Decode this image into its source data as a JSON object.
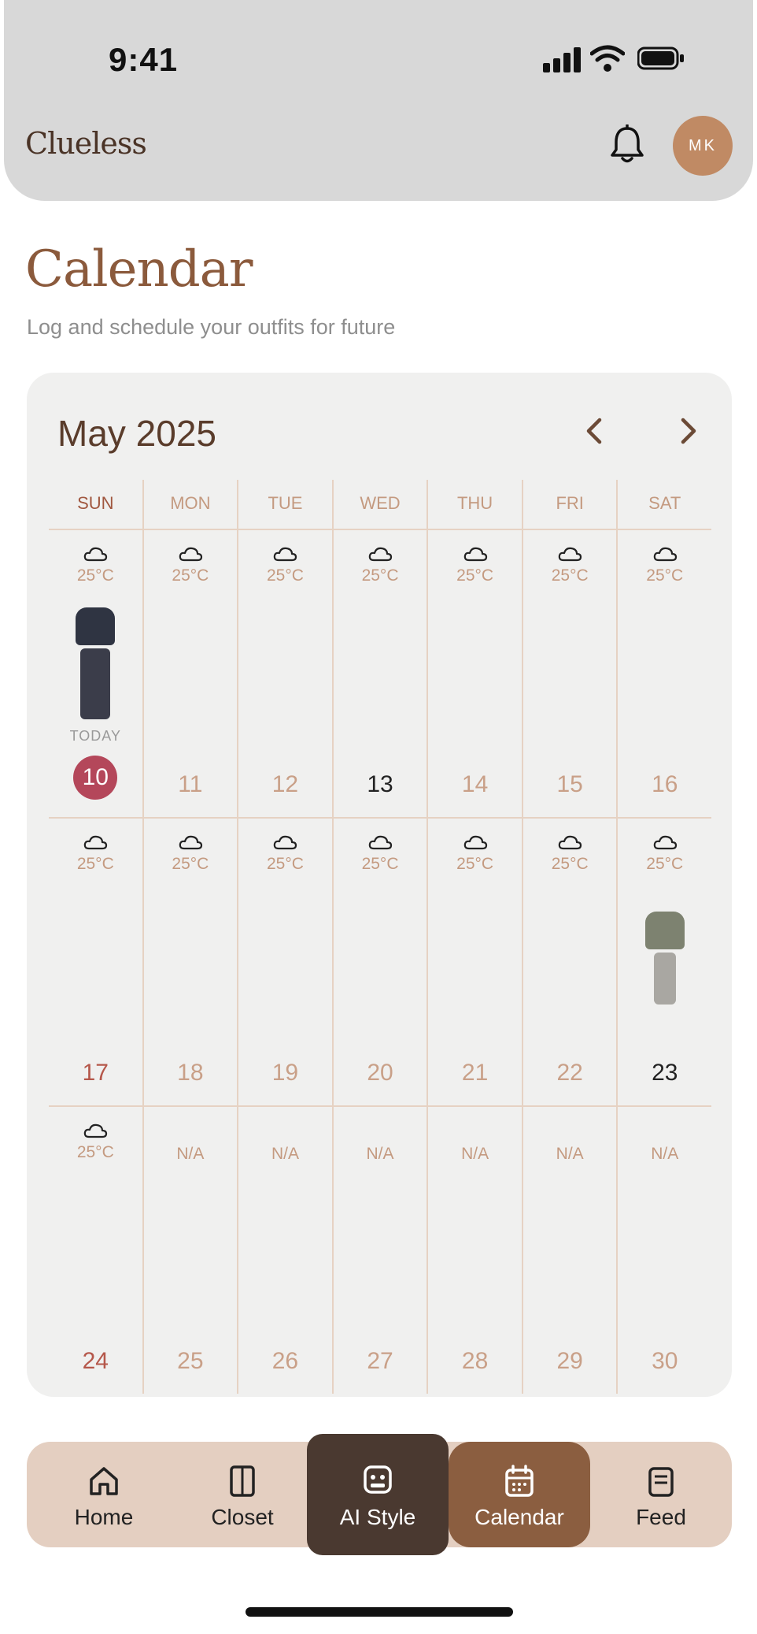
{
  "status_bar": {
    "time": "9:41"
  },
  "header": {
    "logo": "Clueless",
    "avatar_initials": "MK"
  },
  "page": {
    "title": "Calendar",
    "subtitle": "Log and schedule your outfits for future"
  },
  "calendar": {
    "month_label": "May 2025",
    "weekdays": [
      "SUN",
      "MON",
      "TUE",
      "WED",
      "THU",
      "FRI",
      "SAT"
    ],
    "today_label": "TODAY",
    "weeks": [
      {
        "days": [
          {
            "num": "10",
            "temp": "25°C",
            "today": true
          },
          {
            "num": "11",
            "temp": "25°C"
          },
          {
            "num": "12",
            "temp": "25°C"
          },
          {
            "num": "13",
            "temp": "25°C"
          },
          {
            "num": "14",
            "temp": "25°C"
          },
          {
            "num": "15",
            "temp": "25°C"
          },
          {
            "num": "16",
            "temp": "25°C"
          }
        ]
      },
      {
        "days": [
          {
            "num": "17",
            "temp": "25°C"
          },
          {
            "num": "18",
            "temp": "25°C"
          },
          {
            "num": "19",
            "temp": "25°C"
          },
          {
            "num": "20",
            "temp": "25°C"
          },
          {
            "num": "21",
            "temp": "25°C"
          },
          {
            "num": "22",
            "temp": "25°C"
          },
          {
            "num": "23",
            "temp": "25°C"
          }
        ]
      },
      {
        "days": [
          {
            "num": "24",
            "temp": "25°C"
          },
          {
            "num": "25",
            "temp": "N/A"
          },
          {
            "num": "26",
            "temp": "N/A"
          },
          {
            "num": "27",
            "temp": "N/A"
          },
          {
            "num": "28",
            "temp": "N/A"
          },
          {
            "num": "29",
            "temp": "N/A"
          },
          {
            "num": "30",
            "temp": "N/A"
          }
        ]
      }
    ]
  },
  "bottom_nav": {
    "home": "Home",
    "closet": "Closet",
    "ai_style": "AI Style",
    "calendar": "Calendar",
    "feed": "Feed"
  },
  "icons": [
    "bell-icon",
    "chevron-left-icon",
    "chevron-right-icon",
    "cloud-icon",
    "home-icon",
    "closet-icon",
    "robot-icon",
    "calendar-icon",
    "feed-icon"
  ],
  "colors": {
    "brand": "#8b5a3c",
    "today": "#b4475a",
    "nav_active": "#8b5e40",
    "ai_tab": "#4a3930"
  }
}
